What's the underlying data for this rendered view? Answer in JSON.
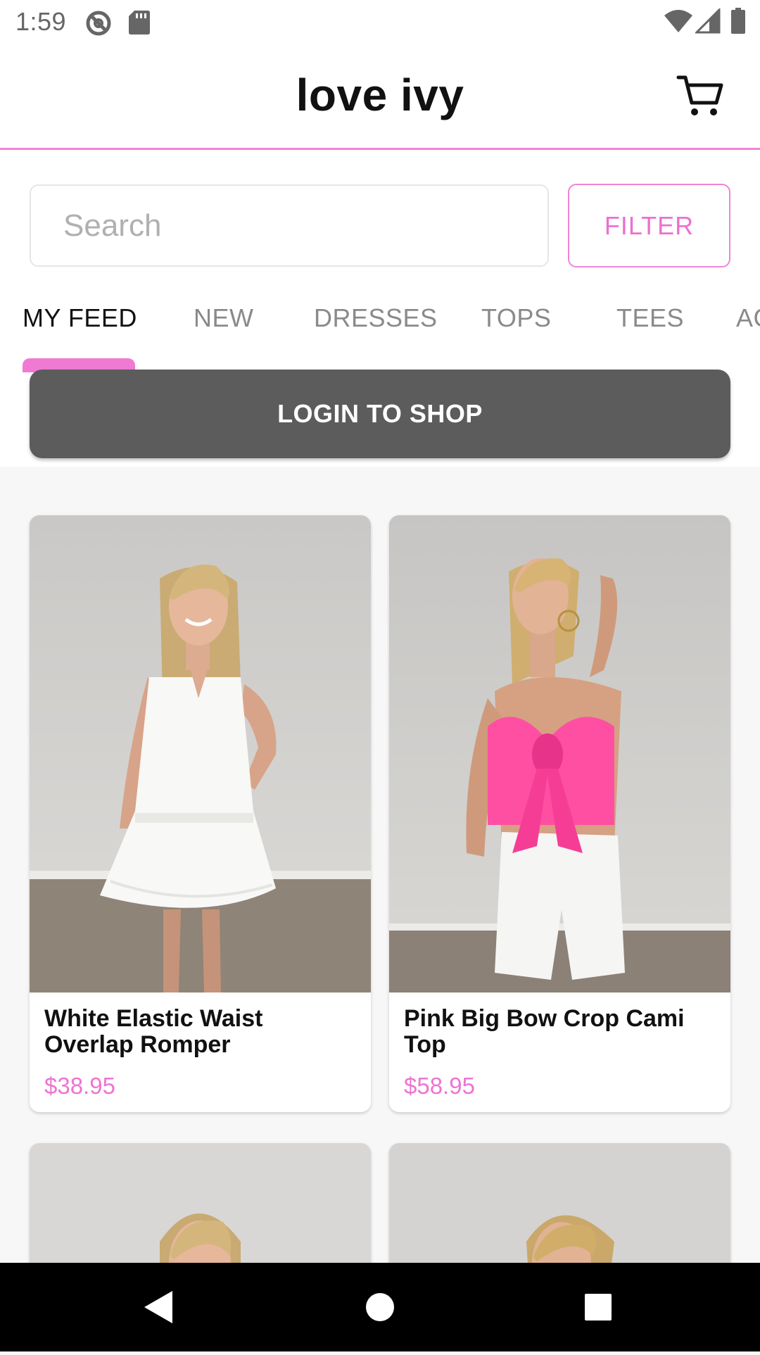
{
  "status_bar": {
    "time": "1:59",
    "icons": [
      "do-not-disturb-icon",
      "sd-card-icon",
      "wifi-icon",
      "cellular-signal-icon",
      "battery-icon"
    ]
  },
  "header": {
    "title": "love ivy",
    "cart_icon": "cart-icon"
  },
  "search": {
    "placeholder": "Search",
    "value": "",
    "filter_label": "FILTER"
  },
  "tabs": [
    {
      "label": "MY FEED",
      "active": true
    },
    {
      "label": "NEW",
      "active": false
    },
    {
      "label": "DRESSES",
      "active": false
    },
    {
      "label": "TOPS",
      "active": false
    },
    {
      "label": "TEES",
      "active": false
    },
    {
      "label": "AC",
      "active": false
    }
  ],
  "login_button": {
    "label": "LOGIN TO SHOP"
  },
  "products": [
    {
      "name": "White Elastic Waist Overlap Romper",
      "price": "$38.95",
      "image": "model-in-white-romper-photo"
    },
    {
      "name": "Pink Big Bow Crop Cami Top",
      "price": "$58.95",
      "image": "model-in-pink-bow-top-photo"
    }
  ],
  "nav_bar": {
    "icons": [
      "back-icon",
      "home-icon",
      "recents-icon"
    ]
  },
  "colors": {
    "accent_pink": "#ee74d1",
    "login_button_bg": "#5c5c5c",
    "background": "#f7f7f7"
  }
}
